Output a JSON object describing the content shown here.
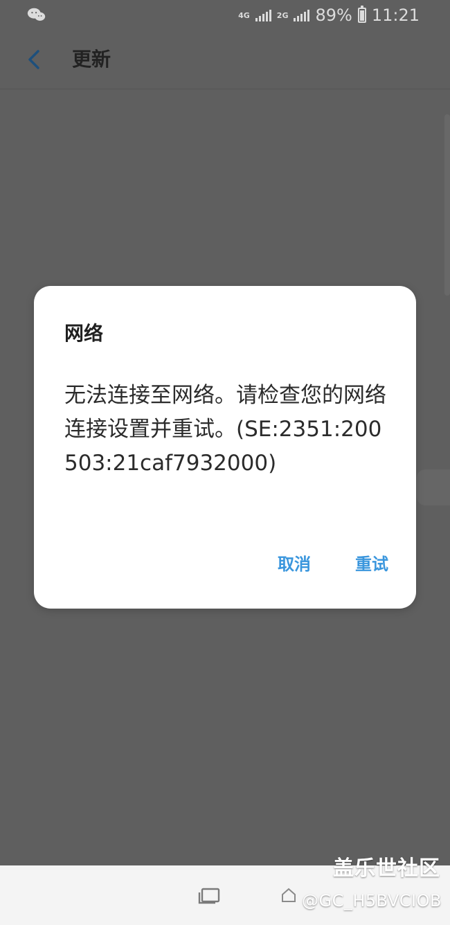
{
  "status_bar": {
    "network_type_1": "4G",
    "network_type_2": "2G",
    "battery_percent": "89%",
    "time": "11:21",
    "icons": [
      "wechat-icon",
      "signal-icon",
      "battery-icon"
    ]
  },
  "app_bar": {
    "title": "更新",
    "back_icon": "back-chevron-icon"
  },
  "dialog": {
    "title": "网络",
    "message": "无法连接至网络。请检查您的网络连接设置并重试。(SE:2351:200503:21caf7932000)",
    "cancel_label": "取消",
    "retry_label": "重试"
  },
  "navigation": {
    "recent_apps_icon": "recent-apps-icon",
    "home_icon": "home-icon"
  },
  "watermark": {
    "title": "盖乐世社区",
    "handle": "@GC_H5BVCIOB"
  },
  "colors": {
    "background_overlay": "#5f5f5f",
    "dialog_background": "#ffffff",
    "accent": "#3a96dd",
    "text_primary": "#222222"
  }
}
